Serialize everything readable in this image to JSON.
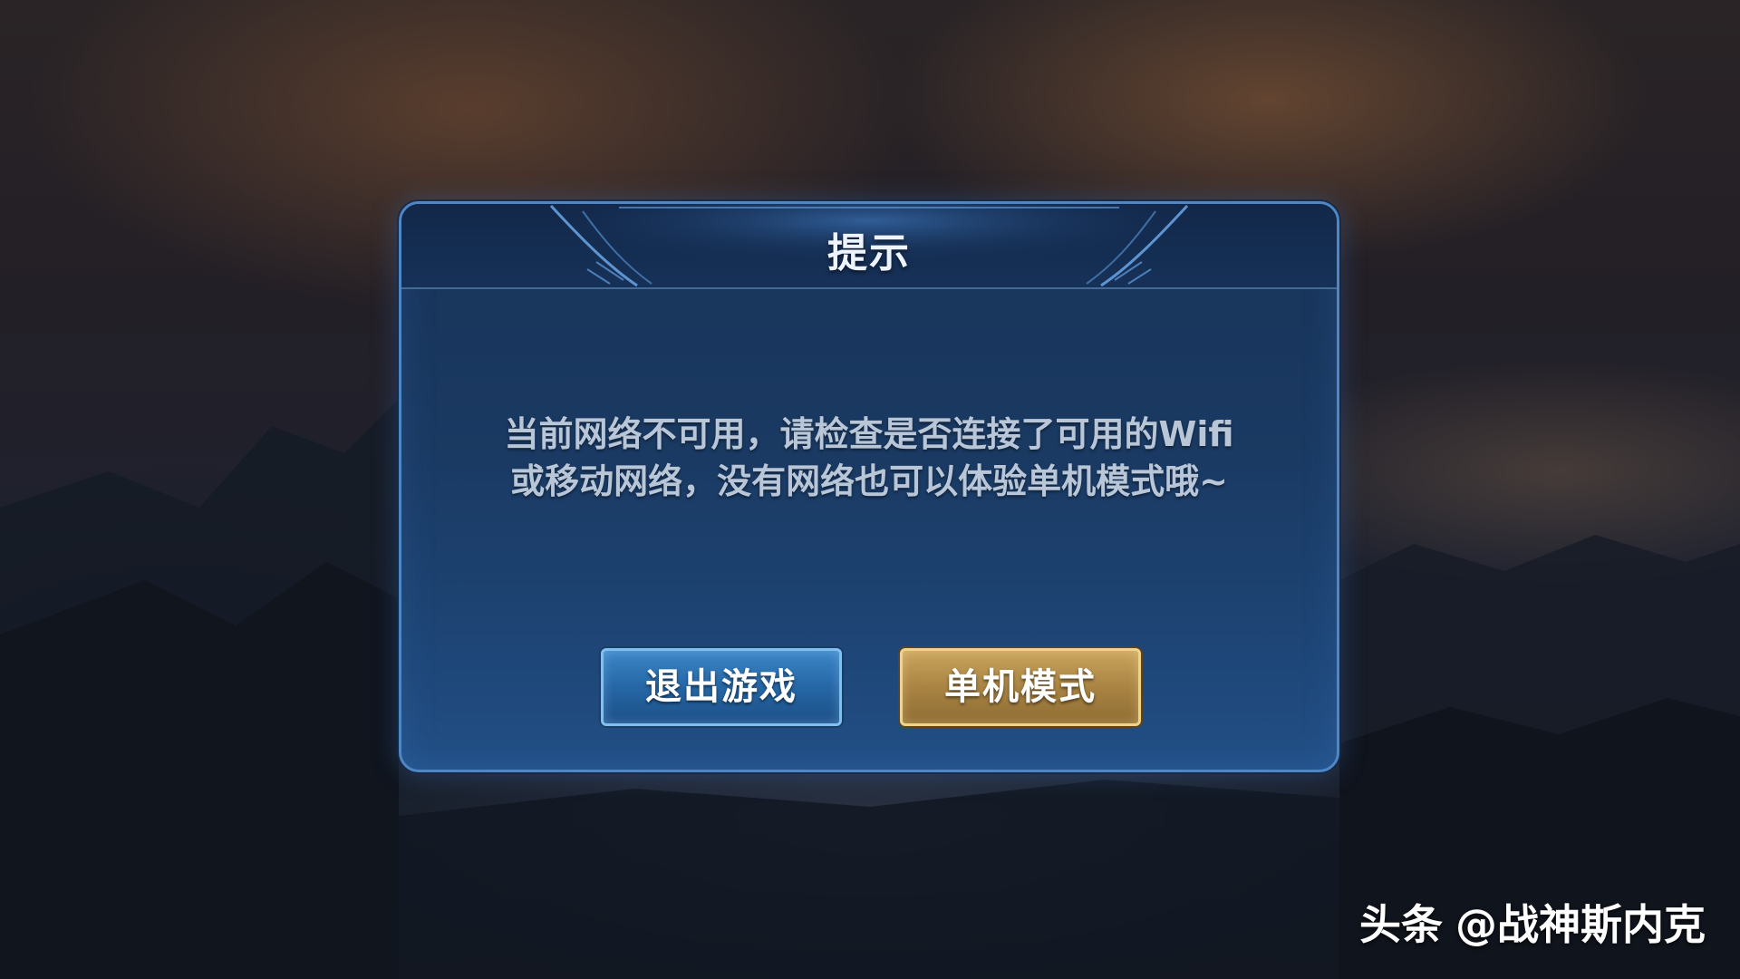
{
  "dialog": {
    "title": "提示",
    "message_lines": [
      "当前网络不可用，请检查是否连接了可用的Wifi",
      "或移动网络，没有网络也可以体验单机模式哦~"
    ],
    "buttons": {
      "exit_label": "退出游戏",
      "solo_label": "单机模式"
    }
  },
  "watermark": {
    "brand": "头条",
    "handle": "@战神斯内克"
  },
  "colors": {
    "panel_blue": "#1a3a63",
    "panel_border": "#4f86c4",
    "exit_button": "#2667a6",
    "solo_button": "#a98443",
    "message_text": "#b8c6d8"
  }
}
